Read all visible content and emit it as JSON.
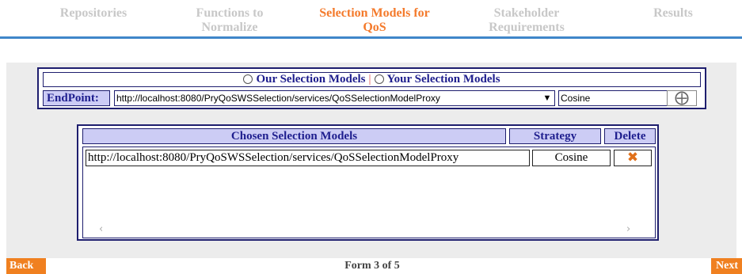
{
  "wizard": {
    "steps": [
      {
        "line1": "Repositories",
        "line2": ""
      },
      {
        "line1": "Functions to",
        "line2": "Normalize"
      },
      {
        "line1": "Selection Models for",
        "line2": "QoS"
      },
      {
        "line1": "Stakeholder",
        "line2": "Requirements"
      },
      {
        "line1": "Results",
        "line2": ""
      }
    ],
    "active_index": 2
  },
  "endpoint_panel": {
    "radio_ours": "Our Selection Models",
    "separator": "|",
    "radio_yours": "Your Selection Models",
    "endpoint_label": "EndPoint:",
    "endpoint_value": "http://localhost:8080/PryQoSWSSelection/services/QoSSelectionModelProxy",
    "strategy_value": "Cosine",
    "add_icon": "plus-icon"
  },
  "chosen_models": {
    "headers": {
      "models": "Chosen Selection Models",
      "strategy": "Strategy",
      "delete": "Delete"
    },
    "rows": [
      {
        "url": "http://localhost:8080/PryQoSWSSelection/services/QoSSelectionModelProxy",
        "strategy": "Cosine",
        "delete_icon": "close-icon"
      }
    ]
  },
  "footer": {
    "back_label": "Back",
    "form_counter": "Form 3 of 5",
    "next_label": "Next"
  },
  "colors": {
    "active_step": "#f47a2b",
    "inactive_step": "#c8c8c8",
    "header_bg": "#ccccf5",
    "nav_button": "#f08020",
    "divider": "#3f86c9"
  }
}
